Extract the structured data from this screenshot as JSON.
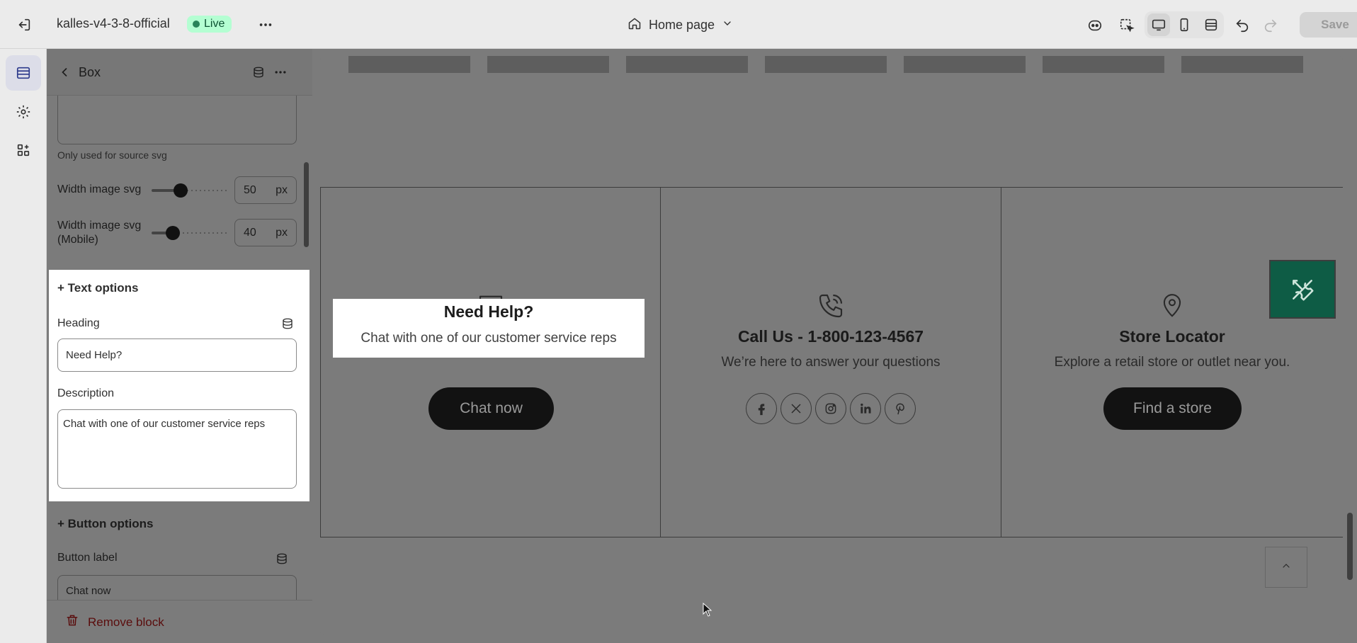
{
  "topbar": {
    "store_name": "kalles-v4-3-8-official",
    "status_badge": "Live",
    "page_label": "Home page",
    "save_label": "Save"
  },
  "panel": {
    "title": "Box",
    "source_svg_hint": "Only used for source svg",
    "width_svg": {
      "label": "Width image svg",
      "value": "50",
      "unit": "px",
      "level": 0.45
    },
    "width_svg_mobile": {
      "label": "Width image svg (Mobile)",
      "value": "40",
      "unit": "px",
      "level": 0.3
    },
    "text_options": {
      "title": "+ Text options",
      "heading_label": "Heading",
      "heading_value": "Need Help?",
      "description_label": "Description",
      "description_value": "Chat with one of our customer service reps"
    },
    "button_options": {
      "title": "+ Button options",
      "button_label_label": "Button label",
      "button_label_value": "Chat now"
    },
    "remove_label": "Remove block"
  },
  "preview": {
    "boxes": [
      {
        "icon": "chat-icon",
        "heading": "Need Help?",
        "description": "Chat with one of our customer service reps",
        "button": "Chat now"
      },
      {
        "icon": "phone-icon",
        "heading": "Call Us - 1-800-123-4567",
        "description": "We’re here to answer your questions",
        "socials": [
          "facebook-icon",
          "x-icon",
          "instagram-icon",
          "linkedin-icon",
          "pinterest-icon"
        ]
      },
      {
        "icon": "location-pin-icon",
        "heading": "Store Locator",
        "description": "Explore a retail store or outlet near you.",
        "button": "Find a store"
      }
    ]
  },
  "colors": {
    "live_badge_bg": "#b4fed2",
    "accent_green": "#0e5c45",
    "remove_red": "#8e1f0b"
  }
}
